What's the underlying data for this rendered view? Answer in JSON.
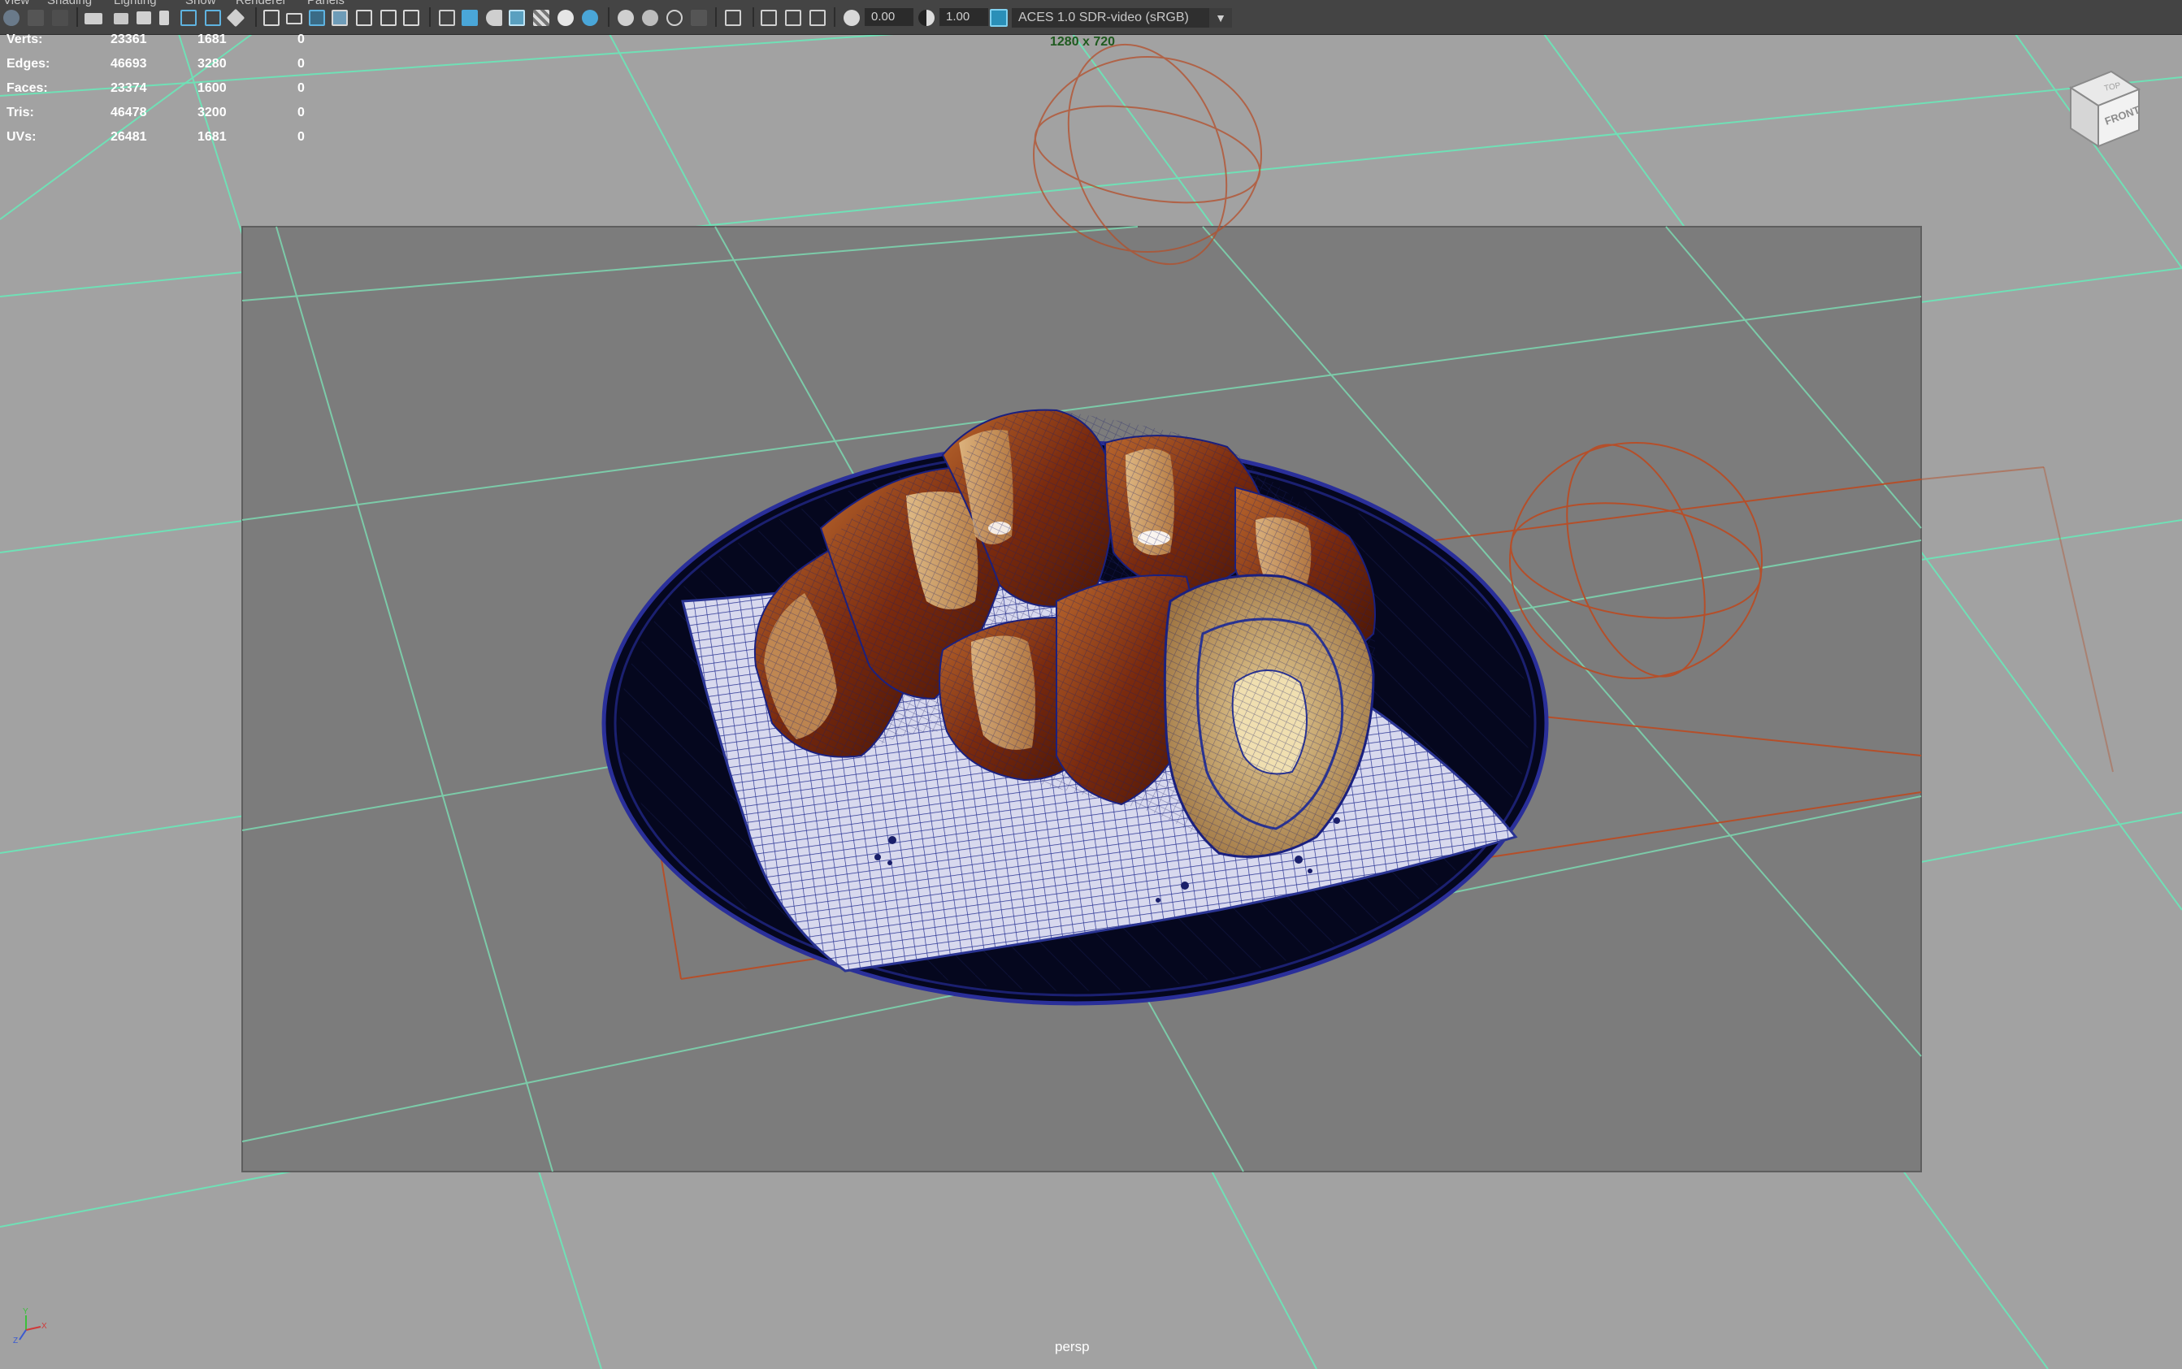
{
  "menu": [
    "View",
    "Shading",
    "Lighting",
    "Show",
    "Renderer",
    "Panels"
  ],
  "toolbar": {
    "exposure_value": "0.00",
    "gamma_value": "1.00",
    "color_space": "ACES 1.0 SDR-video (sRGB)"
  },
  "hud": {
    "rows": [
      {
        "label": "Verts:",
        "v1": "23361",
        "v2": "1681",
        "v3": "0"
      },
      {
        "label": "Edges:",
        "v1": "46693",
        "v2": "3280",
        "v3": "0"
      },
      {
        "label": "Faces:",
        "v1": "23374",
        "v2": "1600",
        "v3": "0"
      },
      {
        "label": "Tris:",
        "v1": "46478",
        "v2": "3200",
        "v3": "0"
      },
      {
        "label": "UVs:",
        "v1": "26481",
        "v2": "1681",
        "v3": "0"
      }
    ]
  },
  "resolution_gate": "1280 x 720",
  "camera_name": "persp",
  "viewcube": {
    "top_label": "TOP",
    "front_label": "FRONT"
  },
  "axis": {
    "x": "X",
    "y": "Y",
    "z": "Z"
  },
  "colors": {
    "background": "#a2a2a2",
    "grid_line": "#6fe0b4",
    "gate": "#7d7d7d",
    "light_gizmo": "#b8502a",
    "plate": "#080a2a",
    "wireframe": "#1e2a8a",
    "croissant": "#8a3a14",
    "toolbar": "#444444"
  }
}
